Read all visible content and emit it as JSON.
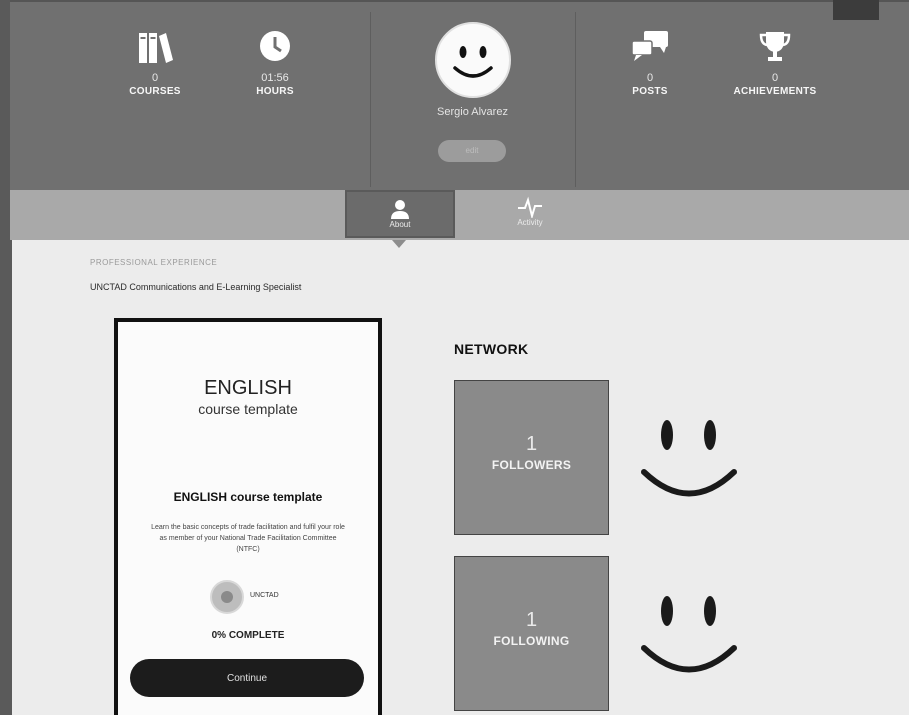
{
  "header": {
    "stats_left": [
      {
        "icon": "books-icon",
        "value": "0",
        "label": "COURSES"
      },
      {
        "icon": "clock-icon",
        "value": "01:56",
        "label": "HOURS"
      }
    ],
    "stats_right": [
      {
        "icon": "chat-bubbles-icon",
        "value": "0",
        "label": "POSTS"
      },
      {
        "icon": "trophy-icon",
        "value": "0",
        "label": "ACHIEVEMENTS"
      }
    ],
    "user": {
      "name": "Sergio Alvarez",
      "avatar_icon": "smiley-icon"
    },
    "edit_label": "edit"
  },
  "tabs": [
    {
      "label": "About",
      "icon": "person-icon",
      "active": true
    },
    {
      "label": "Activity",
      "icon": "pulse-icon",
      "active": false
    }
  ],
  "profile": {
    "heading": "PROFESSIONAL EXPERIENCE",
    "text": "UNCTAD Communications and E-Learning Specialist"
  },
  "course": {
    "cover_title": "ENGLISH",
    "cover_subtitle": "course template",
    "title": "ENGLISH course template",
    "description": "Learn the basic concepts of trade facilitation and fulfil your role as member of your National Trade Facilitation Committee (NTFC)",
    "org": "UNCTAD",
    "progress_text": "0% COMPLETE",
    "progress_value": 0,
    "continue_label": "Continue"
  },
  "network": {
    "title": "NETWORK",
    "followers": {
      "count": "1",
      "label": "FOLLOWERS"
    },
    "following": {
      "count": "1",
      "label": "FOLLOWING"
    }
  },
  "colors": {
    "hero": "#707070",
    "tabbar": "#a9a9a9",
    "tab_active": "#6b6b6b",
    "network_box": "#8a8a8a",
    "button_dark": "#1c1c1c"
  }
}
